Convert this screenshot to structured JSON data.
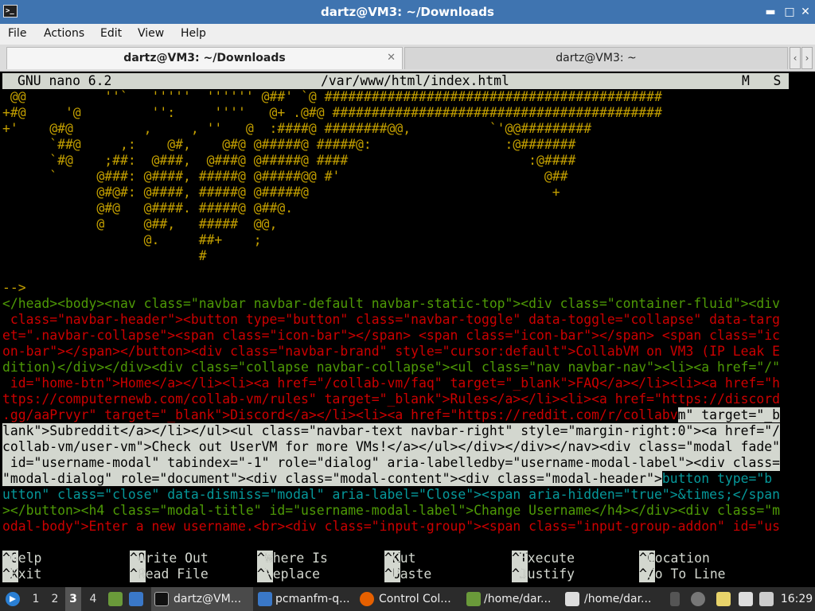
{
  "window": {
    "title": "dartz@VM3: ~/Downloads",
    "app_icon": ">_"
  },
  "menu": [
    "File",
    "Actions",
    "Edit",
    "View",
    "Help"
  ],
  "tabs": [
    {
      "label": "dartz@VM3: ~/Downloads",
      "active": true
    },
    {
      "label": "dartz@VM3: ~",
      "active": false
    }
  ],
  "nano": {
    "version": "GNU nano 6.2",
    "file": "/var/www/html/index.html",
    "flags": "M   S"
  },
  "ascii_art": [
    " @@          ''`   '''''  '''''' @##' `@ ###########################################",
    "+#@     '@         '':     ''''   @+ .@#@ ##########################################",
    "+'    @#@         ,     , ''   @  :####@ ########@@,          `'@@#########",
    "      `##@     ,:    @#,    @#@ @#####@ #####@:                 :@#######",
    "      `#@    ;##:  @###,  @###@ @#####@ ####                       :@####",
    "      `     @###: @####, #####@ @#####@@ #'                          @##",
    "            @#@#: @####, #####@ @#####@                               +",
    "            @#@   @####. #####@ @##@.",
    "            @     @##,   #####  @@,",
    "                  @.     ##+    ;",
    "                         #"
  ],
  "code_lines": [
    "-->",
    "</head><body><nav class=\"navbar navbar-default navbar-static-top\"><div class=\"container-fluid\"><div",
    " class=\"navbar-header\"><button type=\"button\" class=\"navbar-toggle\" data-toggle=\"collapse\" data-targ",
    "et=\".navbar-collapse\"><span class=\"icon-bar\"></span> <span class=\"icon-bar\"></span> <span class=\"ic",
    "on-bar\"></span></button><div class=\"navbar-brand\" style=\"cursor:default\">CollabVM on VM3 (IP Leak E",
    "dition)</div></div><div class=\"collapse navbar-collapse\"><ul class=\"nav navbar-nav\"><li><a href=\"/\"",
    " id=\"home-btn\">Home</a></li><li><a href=\"/collab-vm/faq\" target=\"_blank\">FAQ</a></li><li><a href=\"h",
    "ttps://computernewb.com/collab-vm/rules\" target=\"_blank\">Rules</a></li><li><a href=\"https://discord",
    ".gg/aaPrvyr\" target=\"_blank\">Discord</a></li><li><a href=\"https://reddit.com/r/collabv",
    "lank\">Subreddit</a></li></ul><ul class=\"navbar-text navbar-right\" style=\"margin-right:0\"><a href=\"/",
    "collab-vm/user-vm\">Check out UserVM for more VMs!</a></ul></div></div></nav><div class=\"modal fade\"",
    " id=\"username-modal\" tabindex=\"-1\" role=\"dialog\" aria-labelledby=\"username-modal-label\"><div class=",
    "\"modal-dialog\" role=\"document\"><div class=\"modal-content\"><div class=\"modal-header\">",
    "utton\" class=\"close\" data-dismiss=\"modal\" aria-label=\"Close\"><span aria-hidden=\"true\">&times;</span",
    "></button><h4 class=\"modal-title\" id=\"username-modal-label\">Change Username</h4></div><div class=\"m",
    "odal-body\">Enter a new username.<br><div class=\"input-group\"><span class=\"input-group-addon\" id=\"us"
  ],
  "selection_tail": {
    "line9": "m\" target=\"_b",
    "line13": "button type=\"b"
  },
  "shortcuts": [
    [
      {
        "key": "^G",
        "label": "Help"
      },
      {
        "key": "^O",
        "label": "Write Out"
      },
      {
        "key": "^W",
        "label": "Where Is"
      },
      {
        "key": "^K",
        "label": "Cut"
      },
      {
        "key": "^T",
        "label": "Execute"
      },
      {
        "key": "^C",
        "label": "Location"
      }
    ],
    [
      {
        "key": "^X",
        "label": "Exit"
      },
      {
        "key": "^R",
        "label": "Read File"
      },
      {
        "key": "^\\",
        "label": "Replace"
      },
      {
        "key": "^U",
        "label": "Paste"
      },
      {
        "key": "^J",
        "label": "Justify"
      },
      {
        "key": "^/",
        "label": "Go To Line"
      }
    ]
  ],
  "taskbar": {
    "desktops": [
      "1",
      "2",
      "3",
      "4"
    ],
    "active_desktop": "3",
    "tasks": [
      "dartz@VM...",
      "pcmanfm-q...",
      "Control Col...",
      "/home/dar...",
      "/home/dar..."
    ],
    "clock": "16:29"
  },
  "colors": {
    "titlebar": "#3f74b0",
    "taskbar": "#2b2b2b",
    "nano_bar": "#d3d7cf",
    "ascii": "#c4a000",
    "tag": "#4e9a06",
    "attr": "#cc0000"
  }
}
